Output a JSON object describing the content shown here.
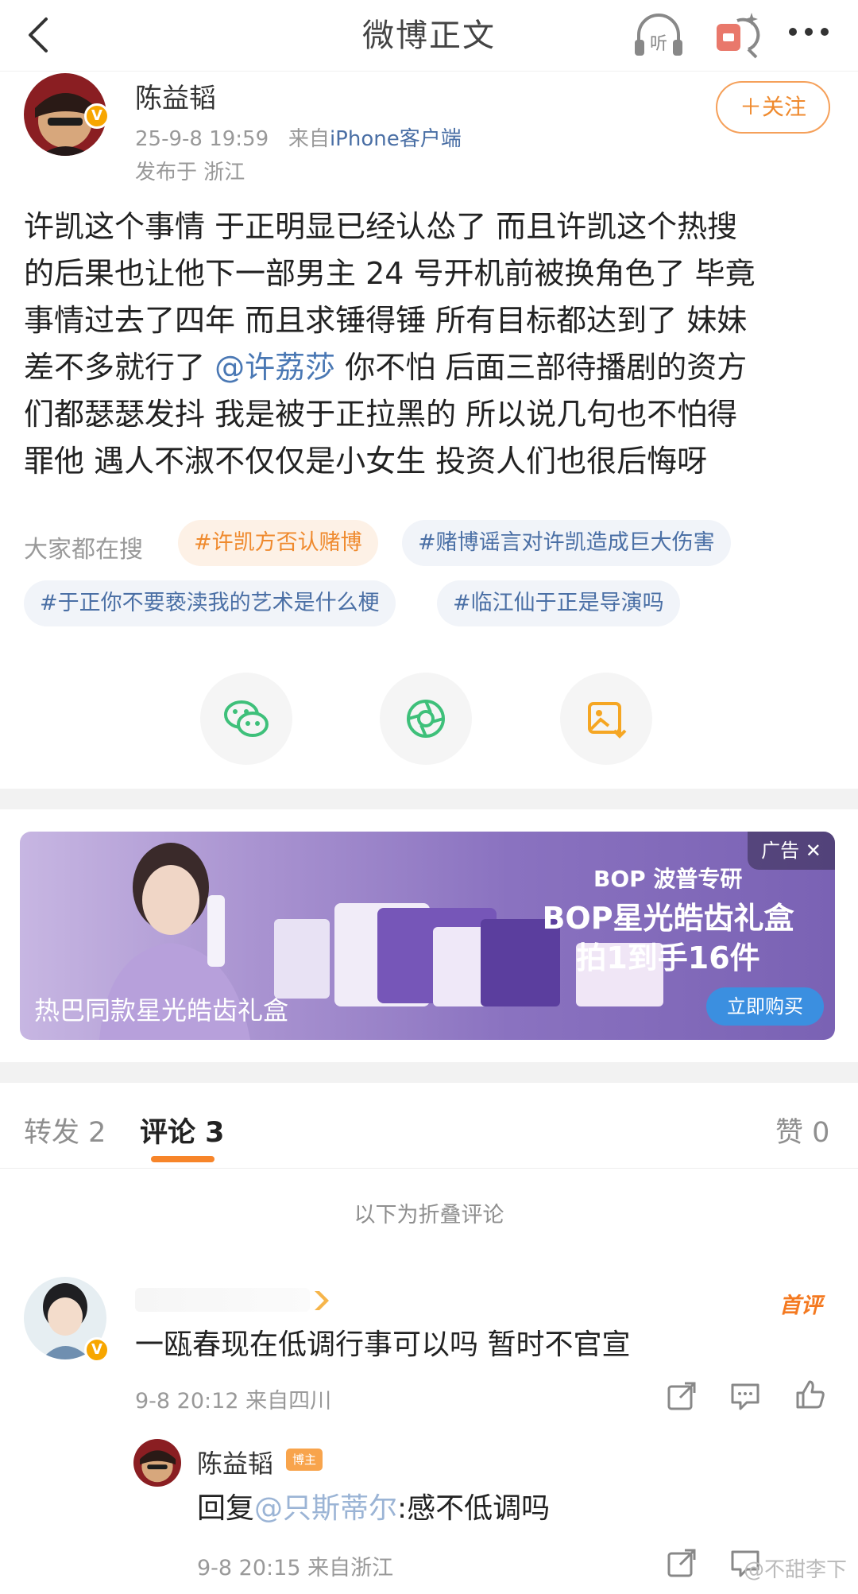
{
  "header": {
    "title": "微博正文"
  },
  "post": {
    "author": "陈益韬",
    "timestamp": "25-9-8 19:59",
    "source_prefix": "来自",
    "source": "iPhone客户端",
    "location": "发布于 浙江",
    "follow_label": "＋关注",
    "text_lines": [
      "许凯这个事情 于正明显已经认怂了 而且许凯这个热搜",
      "的后果也让他下一部男主 24 号开机前被换角色了 毕竟",
      "事情过去了四年 而且求锤得锤 所有目标都达到了 妹妹",
      "差不多就行了",
      "@许荔莎",
      "你不怕 后面三部待播剧的资方",
      "们都瑟瑟发抖 我是被于正拉黑的 所以说几句也不怕得",
      "罪他 遇人不淑不仅仅是小女生 投资人们也很后悔呀"
    ]
  },
  "topics": {
    "label": "大家都在搜",
    "items": [
      "#许凯方否认赌博",
      "#赌博谣言对许凯造成巨大伤害",
      "#于正你不要亵渎我的艺术是什么梗",
      "#临江仙于正是导演吗"
    ]
  },
  "share": [
    "wechat-icon",
    "moments-icon",
    "save-image-icon"
  ],
  "ad": {
    "tag": "广告 ✕",
    "brand": "BOP 波普专研",
    "headline_1": "BOP星光皓齿礼盒",
    "headline_2": "拍1到手16件",
    "caption": "热巴同款星光皓齿礼盒",
    "buy_label": "立即购买"
  },
  "tabs": {
    "repost": "转发 2",
    "comment": "评论 3",
    "like": "赞 0"
  },
  "folded_label": "以下为折叠评论",
  "comments": [
    {
      "tag": "首评",
      "text": "一瓯春现在低调行事可以吗 暂时不官宣",
      "meta": "9-8 20:12 来自四川"
    }
  ],
  "reply": {
    "name": "陈益韬",
    "badge": "博主",
    "prefix": "回复",
    "mention": "@只斯蒂尔",
    "suffix": ":感不低调吗",
    "meta": "9-8 20:15 来自浙江"
  },
  "watermark": "@不甜李下",
  "colors": {
    "accent": "#f7852a",
    "link": "#4a78b4",
    "chip_hot_bg": "#fdf1e6",
    "chip_norm_bg": "#f1f4f9"
  }
}
